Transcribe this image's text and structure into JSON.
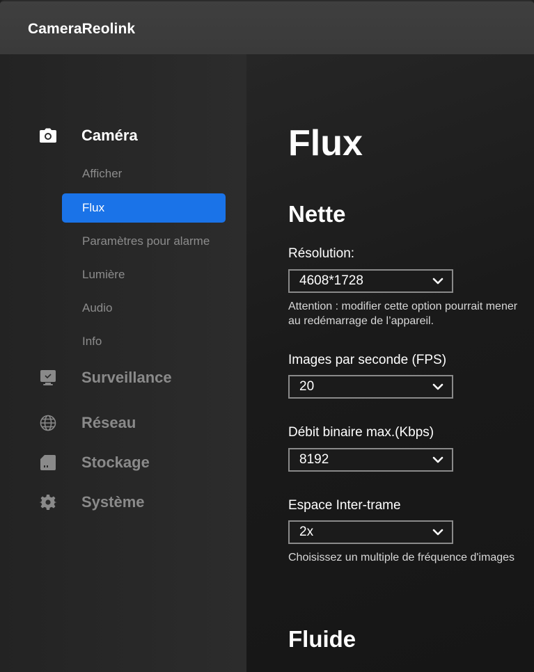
{
  "app": {
    "title": "CameraReolink"
  },
  "sidebar": {
    "sections": [
      {
        "label": "Caméra",
        "icon": "camera-icon"
      },
      {
        "label": "Surveillance",
        "icon": "monitor-icon"
      },
      {
        "label": "Réseau",
        "icon": "globe-icon"
      },
      {
        "label": "Stockage",
        "icon": "sd-card-icon"
      },
      {
        "label": "Système",
        "icon": "gear-icon"
      }
    ],
    "camera_items": [
      {
        "label": "Afficher"
      },
      {
        "label": "Flux"
      },
      {
        "label": "Paramètres pour alarme"
      },
      {
        "label": "Lumière"
      },
      {
        "label": "Audio"
      },
      {
        "label": "Info"
      }
    ],
    "selected_item": "Flux"
  },
  "main": {
    "title": "Flux",
    "groups": [
      {
        "title": "Nette",
        "fields": [
          {
            "label": "Résolution:",
            "value": "4608*1728",
            "hint": "Attention : modifier cette option pourrait mener au redémarrage de l’appareil."
          },
          {
            "label": "Images par seconde (FPS)",
            "value": "20"
          },
          {
            "label": "Débit binaire max.(Kbps)",
            "value": "8192"
          },
          {
            "label": "Espace Inter-trame",
            "value": "2x",
            "hint": "Choisissez un multiple de fréquence d'images"
          }
        ]
      },
      {
        "title": "Fluide"
      }
    ]
  },
  "colors": {
    "accent": "#1a73e8",
    "background": "#1e1e1e",
    "sidebar": "#2a2a2a",
    "titlebar": "#3c3c3c",
    "muted_text": "#8c8c8c"
  }
}
